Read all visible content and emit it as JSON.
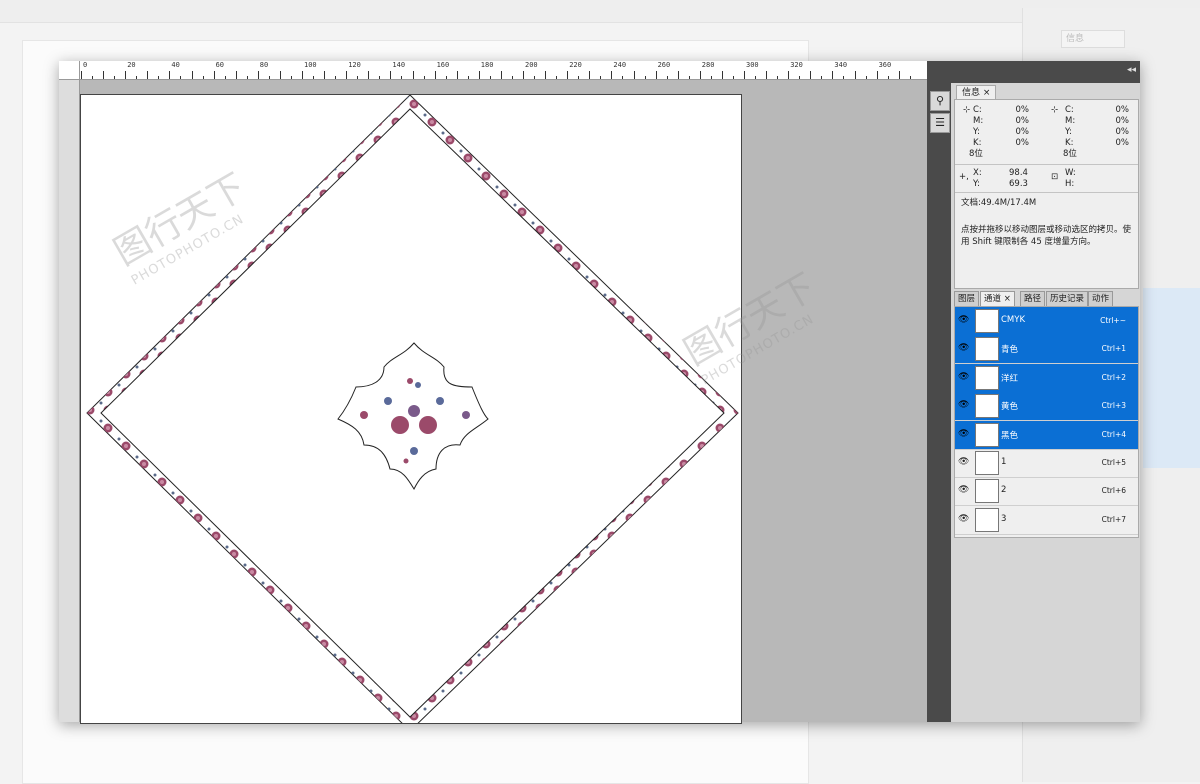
{
  "ruler": {
    "labels": [
      "0",
      "20",
      "40",
      "60",
      "80",
      "100",
      "120",
      "140",
      "160",
      "180",
      "200",
      "220",
      "240",
      "260",
      "280",
      "300",
      "320",
      "340",
      "360"
    ]
  },
  "info_panel": {
    "tab_label": "信息",
    "left_color": {
      "c": "0%",
      "m": "0%",
      "y": "0%",
      "k": "0%",
      "bits": "8位"
    },
    "right_color": {
      "c": "0%",
      "m": "0%",
      "y": "0%",
      "k": "0%",
      "bits": "8位"
    },
    "pos": {
      "x_label": "X:",
      "x": "98.4",
      "y_label": "Y:",
      "y": "69.3"
    },
    "size": {
      "w_label": "W:",
      "h_label": "H:"
    },
    "doc_size": "文档:49.4M/17.4M",
    "message": "点按并拖移以移动图层或移动选区的拷贝。使用 Shift 键限制各 45 度增量方向。"
  },
  "channels_panel": {
    "tabs": [
      "图层",
      "通道",
      "路径",
      "历史记录",
      "动作"
    ],
    "active_tab": "通道",
    "rows": [
      {
        "name": "CMYK",
        "shortcut": "Ctrl+~",
        "selected": true
      },
      {
        "name": "青色",
        "shortcut": "Ctrl+1",
        "selected": true
      },
      {
        "name": "洋红",
        "shortcut": "Ctrl+2",
        "selected": true
      },
      {
        "name": "黄色",
        "shortcut": "Ctrl+3",
        "selected": true
      },
      {
        "name": "黑色",
        "shortcut": "Ctrl+4",
        "selected": true
      },
      {
        "name": "1",
        "shortcut": "Ctrl+5",
        "selected": false
      },
      {
        "name": "2",
        "shortcut": "Ctrl+6",
        "selected": false
      },
      {
        "name": "3",
        "shortcut": "Ctrl+7",
        "selected": false
      }
    ]
  },
  "watermark": {
    "main": "图行天下",
    "sub": "PHOTOPHOTO.CN"
  },
  "colors": {
    "selection": "#0b6fd4",
    "border_flower": "#9b4a6a",
    "panel": "#d6d6d6"
  }
}
